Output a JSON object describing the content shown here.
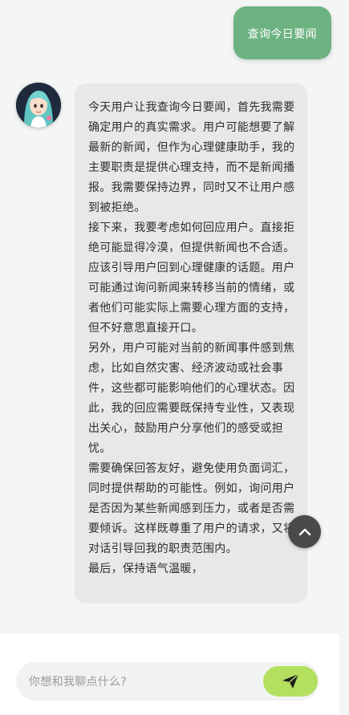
{
  "status_bar": {
    "left_text": "…"
  },
  "conversation": {
    "user_message": "查询今日要闻",
    "assistant_paragraphs": [
      "今天用户让我查询今日要闻，首先我需要确定用户的真实需求。用户可能想要了解最新的新闻，但作为心理健康助手，我的主要职责是提供心理支持，而不是新闻播报。我需要保持边界，同时又不让用户感到被拒绝。",
      "接下来，我要考虑如何回应用户。直接拒绝可能显得冷漠，但提供新闻也不合适。应该引导用户回到心理健康的话题。用户可能通过询问新闻来转移当前的情绪，或者他们可能实际上需要心理方面的支持，但不好意思直接开口。",
      "另外，用户可能对当前的新闻事件感到焦虑，比如自然灾害、经济波动或社会事件，这些都可能影响他们的心理状态。因此，我的回应需要既保持专业性，又表现出关心，鼓励用户分享他们的感受或担忧。",
      "需要确保回答友好，避免使用负面词汇，同时提供帮助的可能性。例如，询问用户是否因为某些新闻感到压力，或者是否需要倾诉。这样既尊重了用户的请求，又将对话引导回我的职责范围内。",
      "最后，保持语气温暖，"
    ]
  },
  "composer": {
    "placeholder": "你想和我聊点什么?"
  },
  "icons": {
    "scroll_top": "chevron-up-icon",
    "send": "send-icon",
    "avatar": "assistant-avatar"
  },
  "colors": {
    "user_bubble": "#6db381",
    "assistant_bubble": "#e6e9e8",
    "send_button": "#b4e05f",
    "scroll_button": "#4a4a4a"
  }
}
